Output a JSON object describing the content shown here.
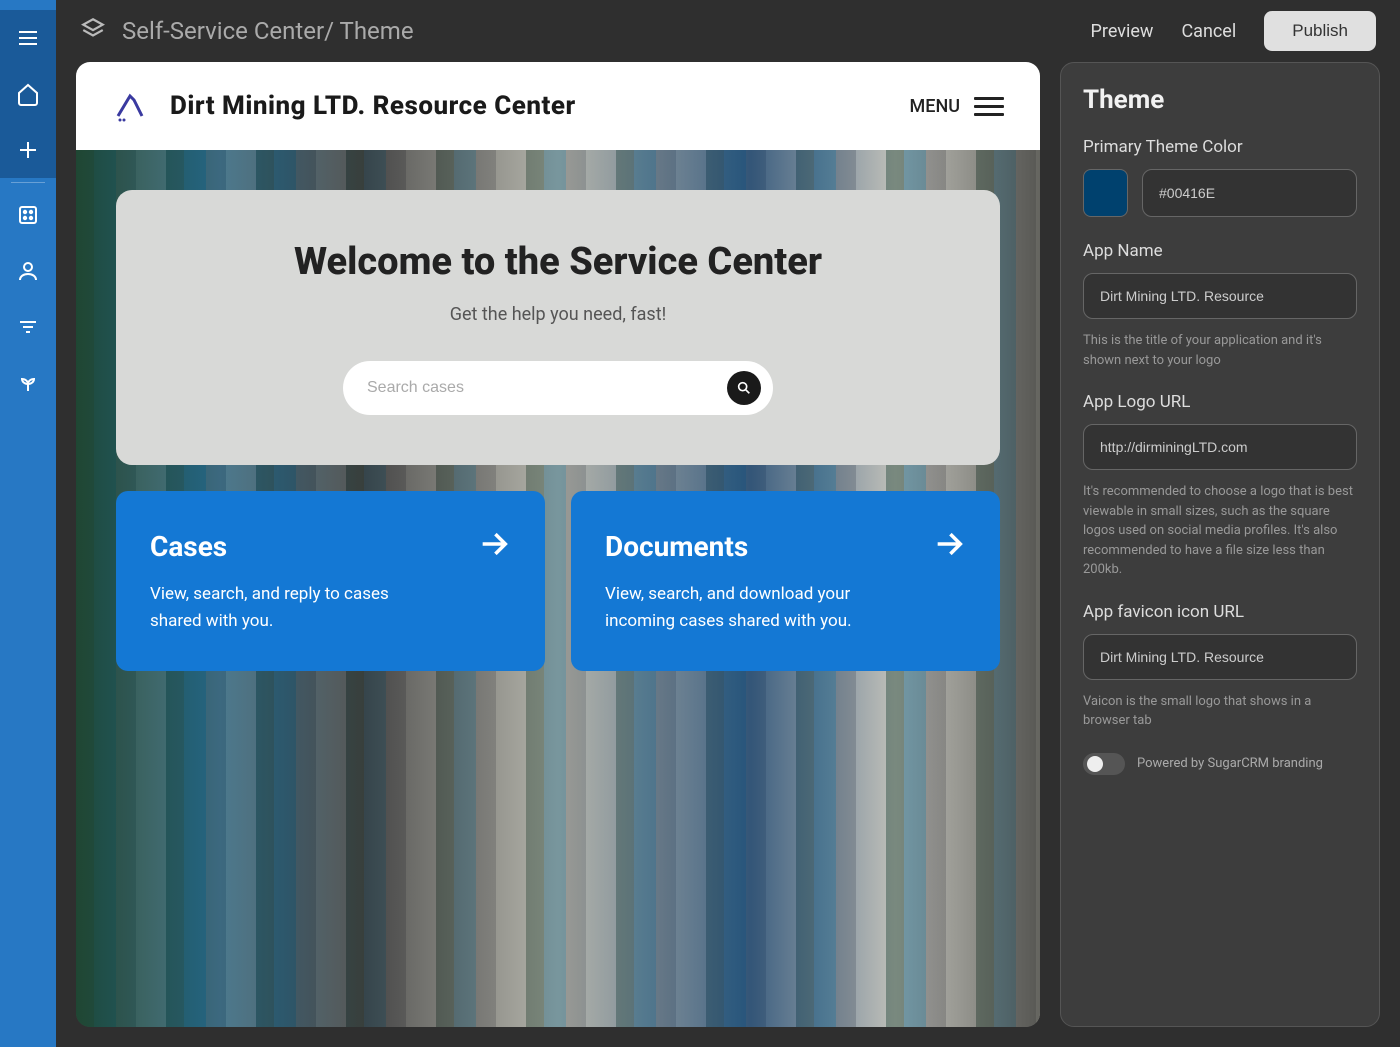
{
  "topbar": {
    "breadcrumb": "Self-Service Center/ Theme",
    "preview": "Preview",
    "cancel": "Cancel",
    "publish": "Publish"
  },
  "preview": {
    "title": "Dirt Mining LTD. Resource Center",
    "menu": "MENU",
    "welcome_title": "Welcome to the Service Center",
    "welcome_sub": "Get the help you need, fast!",
    "search_placeholder": "Search cases",
    "cards": [
      {
        "title": "Cases",
        "desc": "View, search, and reply to cases shared with you."
      },
      {
        "title": "Documents",
        "desc": "View, search, and download your incoming cases shared with you."
      }
    ]
  },
  "settings": {
    "heading": "Theme",
    "primary_color_label": "Primary Theme Color",
    "primary_color_value": "#00416E",
    "app_name_label": "App Name",
    "app_name_value": "Dirt Mining LTD. Resource",
    "app_name_help": "This is the title of your application and it's shown next to your logo",
    "logo_url_label": "App Logo URL",
    "logo_url_value": "http://dirminingLTD.com",
    "logo_url_help": "It's recommended to choose a logo that is best viewable in small sizes, such as the square logos used on social media profiles. It's also recommended to have a file size less than 200kb.",
    "favicon_label": "App favicon icon URL",
    "favicon_value": "Dirt Mining LTD. Resource",
    "favicon_help": "Vaicon is the small logo that shows in a browser tab",
    "branding_label": "Powered by SugarCRM branding"
  }
}
